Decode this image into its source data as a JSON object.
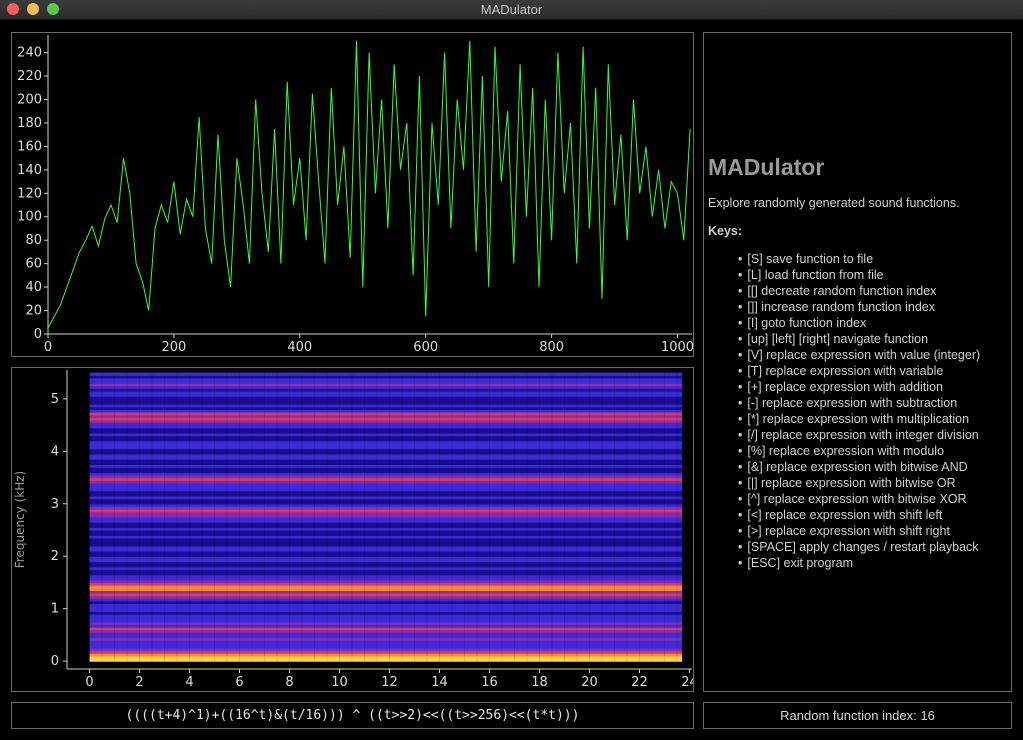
{
  "window": {
    "title": "MADulator"
  },
  "traffic_lights": {
    "close": "#ee5f57",
    "minimize": "#f4bd4f",
    "zoom": "#5cc84a"
  },
  "help": {
    "title": "MADulator",
    "description": "Explore randomly generated sound functions.",
    "keys_title": "Keys:",
    "keys": [
      "[S] save function to file",
      "[L] load function from file",
      "[[] decreate random function index",
      "[]] increase random function index",
      "[I] goto function index",
      "[up] [left] [right] navigate function",
      "[V] replace expression with value (integer)",
      "[T] replace expression with variable",
      "[+] replace expression with addition",
      "[-] replace expression with subtraction",
      "[*] replace expression with multiplication",
      "[/] replace expression with integer division",
      "[%] replace expression with modulo",
      "[&] replace expression with bitwise AND",
      "[|] replace expression with bitwise OR",
      "[^] replace expression with bitwise XOR",
      "[<] replace expression with shift left",
      "[>] replace expression with shift right",
      "[SPACE] apply changes / restart playback",
      "[ESC] exit program"
    ]
  },
  "expression": "((((t+4)^1)+((16^t)&(t/16))) ^ ((t>>2)<<((t>>256)<<(t*t)))",
  "random_index_text": "Random function index: 16",
  "chart_data": [
    {
      "type": "line",
      "series": [
        {
          "color": "#33ff33",
          "x": [
            0,
            10,
            20,
            30,
            40,
            50,
            60,
            70,
            80,
            90,
            100,
            110,
            120,
            130,
            140,
            150,
            160,
            170,
            180,
            190,
            200,
            210,
            220,
            230,
            240,
            250,
            260,
            270,
            280,
            290,
            300,
            310,
            320,
            330,
            340,
            350,
            360,
            370,
            380,
            390,
            400,
            410,
            420,
            430,
            440,
            450,
            460,
            470,
            480,
            490,
            500,
            510,
            520,
            530,
            540,
            550,
            560,
            570,
            580,
            590,
            600,
            610,
            620,
            630,
            640,
            650,
            660,
            670,
            680,
            690,
            700,
            710,
            720,
            730,
            740,
            750,
            760,
            770,
            780,
            790,
            800,
            810,
            820,
            830,
            840,
            850,
            860,
            870,
            880,
            890,
            900,
            910,
            920,
            930,
            940,
            950,
            960,
            970,
            980,
            990,
            1000,
            1010,
            1020
          ],
          "y": [
            5,
            15,
            25,
            40,
            55,
            70,
            80,
            92,
            75,
            98,
            110,
            95,
            150,
            120,
            60,
            45,
            20,
            90,
            110,
            95,
            130,
            85,
            115,
            100,
            185,
            90,
            60,
            170,
            80,
            40,
            150,
            110,
            60,
            200,
            120,
            70,
            175,
            60,
            215,
            110,
            150,
            80,
            205,
            130,
            60,
            210,
            110,
            160,
            65,
            250,
            40,
            240,
            120,
            200,
            90,
            230,
            140,
            180,
            50,
            220,
            15,
            180,
            110,
            240,
            90,
            200,
            140,
            250,
            70,
            220,
            40,
            245,
            130,
            190,
            60,
            230,
            100,
            210,
            40,
            200,
            80,
            240,
            120,
            180,
            60,
            245,
            90,
            210,
            30,
            230,
            110,
            170,
            80,
            200,
            120,
            160,
            100,
            140,
            90,
            130,
            120,
            80,
            175
          ],
          "x_ticks": [
            0,
            200,
            400,
            600,
            800,
            1000
          ],
          "y_ticks": [
            0,
            20,
            40,
            60,
            80,
            100,
            120,
            140,
            160,
            180,
            200,
            220,
            240
          ]
        }
      ],
      "xlim": [
        0,
        1023
      ],
      "ylim": [
        0,
        255
      ]
    },
    {
      "type": "heatmap",
      "ylabel": "Frequency (kHz)",
      "x_ticks": [
        0,
        2,
        4,
        6,
        8,
        10,
        12,
        14,
        16,
        18,
        20,
        22,
        24
      ],
      "y_ticks": [
        0,
        1,
        2,
        3,
        4,
        5
      ],
      "xlim": [
        -0.9,
        24.1
      ],
      "ylim": [
        -0.15,
        5.55
      ],
      "time_range": [
        0,
        23.7
      ],
      "freq_range": [
        0,
        5.5
      ],
      "colormap": [
        "#000030",
        "#1a0c8a",
        "#3a2ad8",
        "#8a2ab0",
        "#d83a60",
        "#ff8a3a",
        "#ffd84a"
      ],
      "bands_khz": [
        0.0,
        0.05,
        0.1,
        0.15,
        0.2,
        0.25,
        0.3,
        0.35,
        0.4,
        0.45,
        0.5,
        0.55,
        0.6,
        0.65,
        0.7,
        0.75,
        0.8,
        0.85,
        0.9,
        0.95,
        1.0,
        1.05,
        1.1,
        1.15,
        1.2,
        1.25,
        1.3,
        1.35,
        1.4,
        1.45,
        1.5,
        1.55,
        1.6,
        1.65,
        1.7,
        1.75,
        1.8,
        1.85,
        1.9,
        1.95,
        2.0,
        2.05,
        2.1,
        2.15,
        2.2,
        2.25,
        2.3,
        2.35,
        2.4,
        2.45,
        2.5,
        2.55,
        2.6,
        2.65,
        2.7,
        2.75,
        2.8,
        2.85,
        2.9,
        2.95,
        3.0,
        3.05,
        3.1,
        3.15,
        3.2,
        3.25,
        3.3,
        3.35,
        3.4,
        3.45,
        3.5,
        3.55,
        3.6,
        3.65,
        3.7,
        3.75,
        3.8,
        3.85,
        3.9,
        3.95,
        4.0,
        4.05,
        4.1,
        4.15,
        4.2,
        4.25,
        4.3,
        4.35,
        4.4,
        4.45,
        4.5,
        4.55,
        4.6,
        4.65,
        4.7,
        4.75,
        4.8,
        4.85,
        4.9,
        4.95,
        5.0,
        5.05,
        5.1,
        5.15,
        5.2,
        5.25,
        5.3,
        5.35,
        5.4,
        5.45
      ],
      "band_levels": [
        6,
        6,
        5,
        4,
        3,
        2,
        2,
        2,
        3,
        2,
        2,
        3,
        4,
        2,
        3,
        2,
        2,
        2,
        1,
        2,
        2,
        2,
        1,
        2,
        3,
        4,
        3,
        5,
        5,
        4,
        3,
        2,
        2,
        1,
        1,
        2,
        1,
        1,
        2,
        2,
        1,
        1,
        2,
        2,
        1,
        1,
        1,
        2,
        1,
        1,
        2,
        1,
        1,
        2,
        2,
        3,
        3,
        4,
        3,
        2,
        1,
        1,
        2,
        1,
        1,
        2,
        2,
        2,
        3,
        4,
        3,
        2,
        1,
        1,
        2,
        1,
        1,
        2,
        2,
        1,
        1,
        2,
        2,
        2,
        1,
        1,
        2,
        1,
        1,
        2,
        2,
        3,
        4,
        3,
        4,
        2,
        1,
        2,
        1,
        1,
        1,
        2,
        2,
        1,
        2,
        3,
        2,
        2,
        1,
        2
      ]
    }
  ]
}
